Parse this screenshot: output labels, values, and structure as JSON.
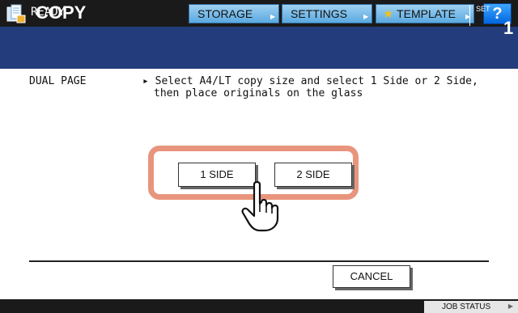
{
  "header": {
    "title": "COPY",
    "app_icon": "copy-icon",
    "buttons": {
      "storage": "STORAGE",
      "settings": "SETTINGS",
      "template": "TEMPLATE",
      "help": "?"
    }
  },
  "status": {
    "text": "READY",
    "set_label": "SET",
    "set_count": "1"
  },
  "main": {
    "mode_label": "DUAL PAGE",
    "instruction_line1": "▸ Select A4/LT copy size and select 1 Side or 2 Side,",
    "instruction_line2": "then place originals on the glass",
    "option_buttons": [
      "1 SIDE",
      "2 SIDE"
    ],
    "cancel": "CANCEL"
  },
  "footer": {
    "job_status": "JOB STATUS"
  },
  "colors": {
    "topbar": "#1a1a1a",
    "status_band": "#233c7c",
    "toolbar_button": "#7cc0ec",
    "help_button": "#0a7bff",
    "highlight": "#e8957d"
  },
  "icons": [
    "copy-icon",
    "star-icon",
    "pointing-hand-icon"
  ]
}
